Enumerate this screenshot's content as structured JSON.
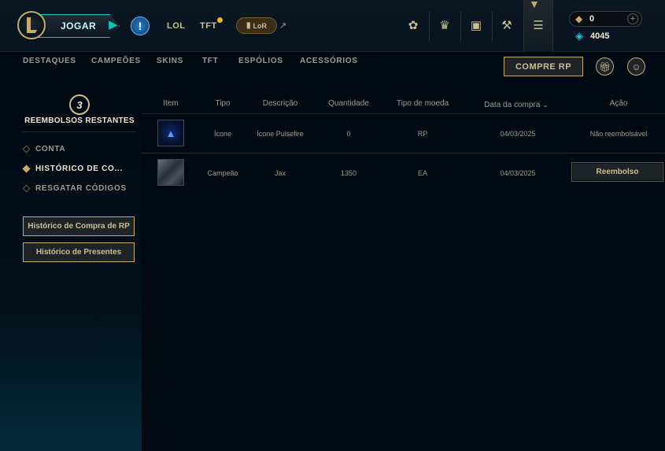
{
  "topbar": {
    "play_label": "JOGAR",
    "alert_glyph": "!",
    "games": [
      "LOL",
      "TFT"
    ],
    "lor_label": "LoR",
    "ext_glyph": "↗",
    "icons": [
      "lotus-icon",
      "trophy-icon",
      "backpack-icon",
      "crafting-icon",
      "store-icon"
    ],
    "rp_value": "0",
    "be_value": "4045"
  },
  "subnav": {
    "items": [
      "DESTAQUES",
      "CAMPEÕES",
      "SKINS",
      "TFT",
      "ESPÓLIOS",
      "ACESSÓRIOS"
    ],
    "buy_rp_label": "COMPRE RP"
  },
  "sidebar": {
    "refunds_count": "3",
    "refunds_label": "REEMBOLSOS RESTANTES",
    "items": [
      "CONTA",
      "HISTÓRICO DE CO...",
      "RESGATAR CÓDIGOS"
    ],
    "active_index": 1,
    "btn_rp_history": "Histórico de Compra de RP",
    "btn_gift_history": "Histórico de Presentes"
  },
  "table": {
    "headers": [
      "Item",
      "Tipo",
      "Descrição",
      "Quantidade",
      "Tipo de moeda",
      "Data da compra",
      "Ação"
    ],
    "rows": [
      {
        "tipo": "Ícone",
        "descricao": "Ícone Pulsefire",
        "quantidade": "0",
        "moeda": "RP",
        "data": "04/03/2025",
        "acao": "Não reembolsável"
      },
      {
        "tipo": "Campeão",
        "descricao": "Jax",
        "quantidade": "1350",
        "moeda": "EA",
        "data": "04/03/2025",
        "acao": "Reembolso"
      }
    ]
  },
  "colors": {
    "gold": "#c8aa6e",
    "gold_light": "#cdbe91",
    "teal": "#0ac8b9",
    "bg": "#010a13",
    "text": "#a09b8c"
  }
}
